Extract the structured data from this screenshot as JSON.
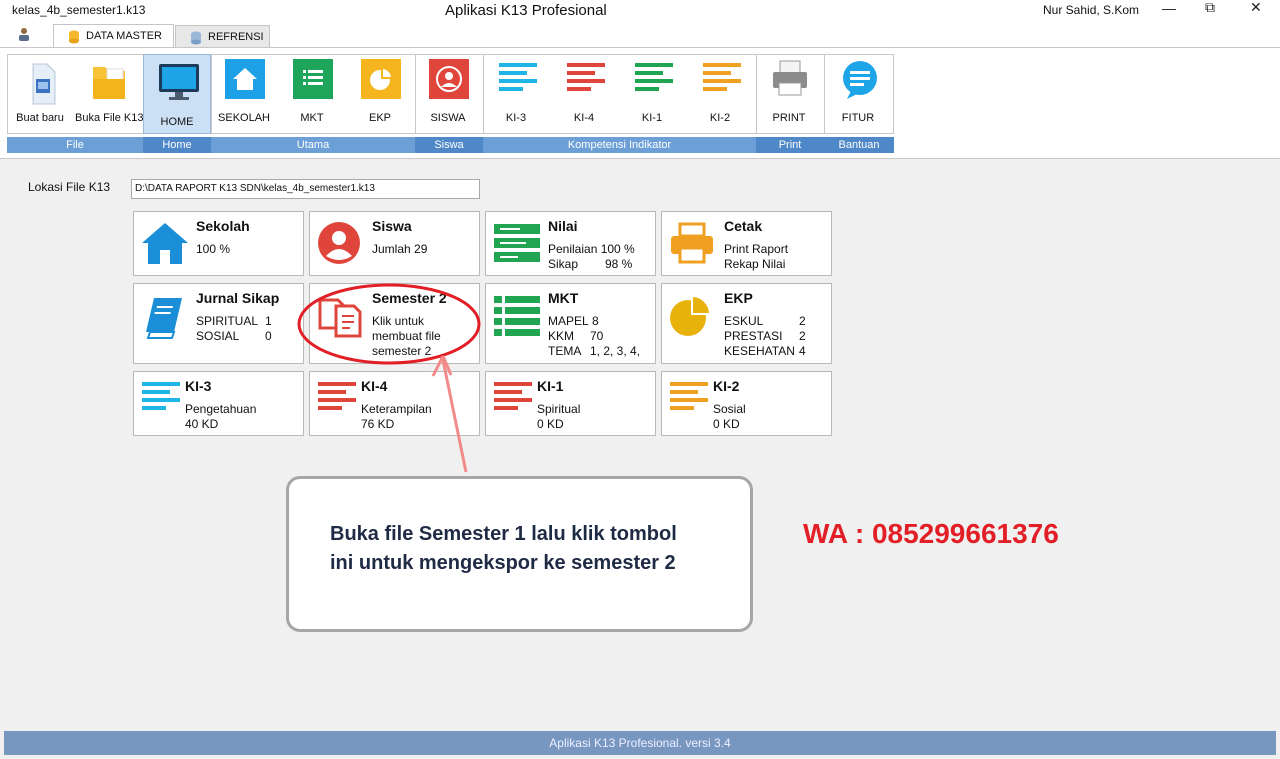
{
  "window": {
    "file_name": "kelas_4b_semester1.k13",
    "app_title": "Aplikasi K13 Profesional",
    "user": "Nur Sahid, S.Kom",
    "minimize": "—",
    "maximize": "⧉",
    "close": "✕"
  },
  "tabs": [
    {
      "label": "DATA MASTER",
      "active": true
    },
    {
      "label": "REFRENSI",
      "active": false
    }
  ],
  "ribbon": {
    "buttons": [
      {
        "label": "Buat baru",
        "icon": "new-file-icon"
      },
      {
        "label": "Buka File K13",
        "icon": "open-folder-icon"
      },
      {
        "label": "HOME",
        "icon": "monitor-icon",
        "selected": true
      },
      {
        "label": "SEKOLAH",
        "icon": "house-icon"
      },
      {
        "label": "MKT",
        "icon": "list-icon"
      },
      {
        "label": "EKP",
        "icon": "pie-icon"
      },
      {
        "label": "SISWA",
        "icon": "person-icon"
      },
      {
        "label": "KI-3",
        "icon": "lines-cyan-icon"
      },
      {
        "label": "KI-4",
        "icon": "lines-red-icon"
      },
      {
        "label": "KI-1",
        "icon": "lines-green-icon"
      },
      {
        "label": "KI-2",
        "icon": "lines-orange-icon"
      },
      {
        "label": "PRINT",
        "icon": "printer-icon"
      },
      {
        "label": "FITUR",
        "icon": "chat-bubble-icon"
      }
    ],
    "groups": [
      "File",
      "Home",
      "Utama",
      "Siswa",
      "Kompetensi Indikator",
      "Print",
      "Bantuan"
    ]
  },
  "location": {
    "label": "Lokasi File K13",
    "value": "D:\\DATA RAPORT K13 SDN\\kelas_4b_semester1.k13"
  },
  "cards": {
    "sekolah": {
      "title": "Sekolah",
      "line1": "100 %"
    },
    "siswa": {
      "title": "Siswa",
      "line1": "Jumlah 29"
    },
    "nilai": {
      "title": "Nilai",
      "line1": "Penilaian 100 %",
      "line2_label": "Sikap",
      "line2_value": "98 %"
    },
    "cetak": {
      "title": "Cetak",
      "line1": "Print Raport",
      "line2": "Rekap Nilai"
    },
    "jurnal": {
      "title": "Jurnal Sikap",
      "rows": [
        {
          "label": "SPIRITUAL",
          "value": "1"
        },
        {
          "label": "SOSIAL",
          "value": "0"
        }
      ]
    },
    "semester2": {
      "title": "Semester 2",
      "line1": "Klik untuk",
      "line2": "membuat file",
      "line3": "semester 2"
    },
    "mkt": {
      "title": "MKT",
      "rows": [
        {
          "label": "MAPEL",
          "value": "8"
        },
        {
          "label": "KKM",
          "value": "70"
        },
        {
          "label": "TEMA",
          "value": "1, 2, 3, 4,"
        }
      ]
    },
    "ekp": {
      "title": "EKP",
      "rows": [
        {
          "label": "ESKUL",
          "value": "2"
        },
        {
          "label": "PRESTASI",
          "value": "2"
        },
        {
          "label": "KESEHATAN",
          "value": "4"
        }
      ]
    },
    "ki3": {
      "title": "KI-3",
      "line1": "Pengetahuan",
      "line2": "40 KD"
    },
    "ki4": {
      "title": "KI-4",
      "line1": "Keterampilan",
      "line2": "76 KD"
    },
    "ki1": {
      "title": "KI-1",
      "line1": "Spiritual",
      "line2": "0 KD"
    },
    "ki2": {
      "title": "KI-2",
      "line1": "Sosial",
      "line2": "0 KD"
    }
  },
  "callout": {
    "line1": "Buka file Semester 1 lalu klik tombol",
    "line2": "ini untuk mengekspor ke semester 2"
  },
  "contact": "WA : 085299661376",
  "status": "Aplikasi K13 Profesional. versi 3.4",
  "colors": {
    "cyan": "#1fb5e6",
    "red": "#e0453b",
    "green": "#22a552",
    "orange": "#f0a020",
    "blue": "#1a8fd8",
    "annotation": "#e21f26"
  }
}
